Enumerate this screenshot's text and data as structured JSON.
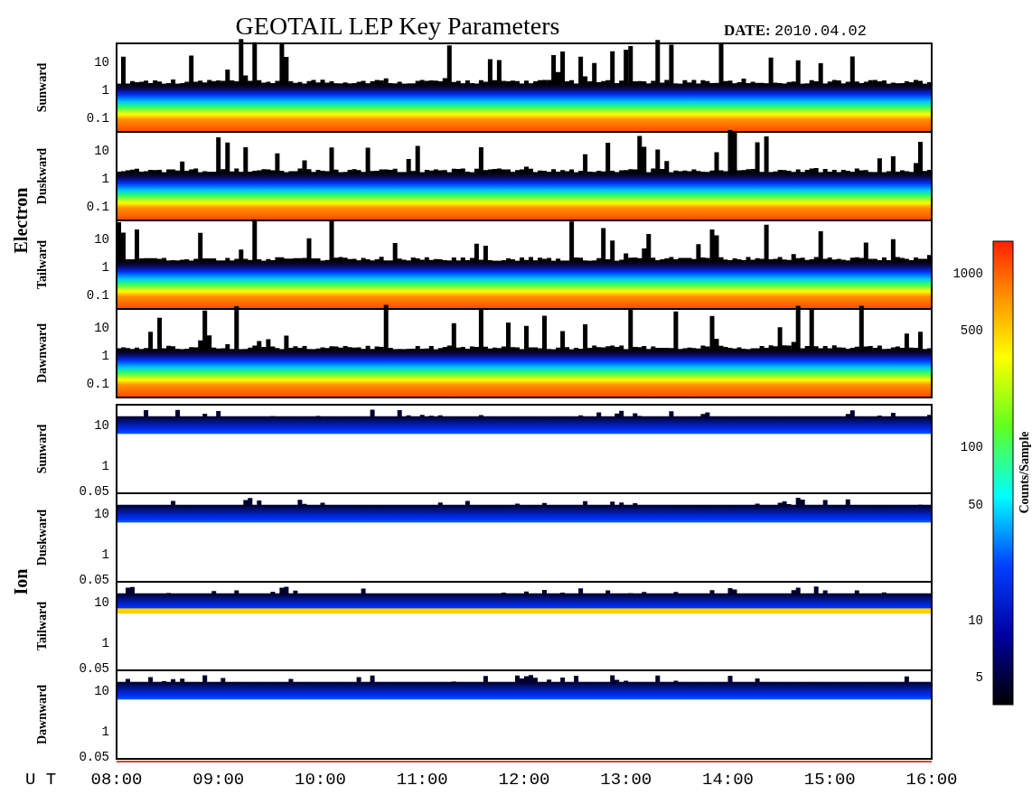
{
  "title": "GEOTAIL LEP Key Parameters",
  "date": {
    "label": "DATE:",
    "value": "2010.04.02"
  },
  "groups": [
    {
      "name": "Electron",
      "kind": "electron",
      "panels": [
        {
          "label": "Sunward",
          "yticks": [
            "10",
            "1",
            "0.1"
          ]
        },
        {
          "label": "Duskward",
          "yticks": [
            "10",
            "1",
            "0.1"
          ]
        },
        {
          "label": "Tailward",
          "yticks": [
            "10",
            "1",
            "0.1"
          ]
        },
        {
          "label": "Dawnward",
          "yticks": [
            "10",
            "1",
            "0.1"
          ]
        }
      ]
    },
    {
      "name": "Ion",
      "kind": "ion",
      "panels": [
        {
          "label": "Sunward",
          "yticks": [
            "10",
            "1",
            "0.05"
          ]
        },
        {
          "label": "Duskward",
          "yticks": [
            "10",
            "1",
            "0.05"
          ]
        },
        {
          "label": "Tailward",
          "yticks": [
            "10",
            "1",
            "0.05"
          ]
        },
        {
          "label": "Dawnward",
          "yticks": [
            "10",
            "1",
            "0.05"
          ]
        }
      ]
    }
  ],
  "x_axis": {
    "label": "U T",
    "ticks": [
      "08:00",
      "09:00",
      "10:00",
      "11:00",
      "12:00",
      "13:00",
      "14:00",
      "15:00",
      "16:00"
    ]
  },
  "colorbar": {
    "title": "Counts/Sample",
    "ticks": [
      "1000",
      "500",
      "100",
      "50",
      "10",
      "5"
    ]
  }
}
